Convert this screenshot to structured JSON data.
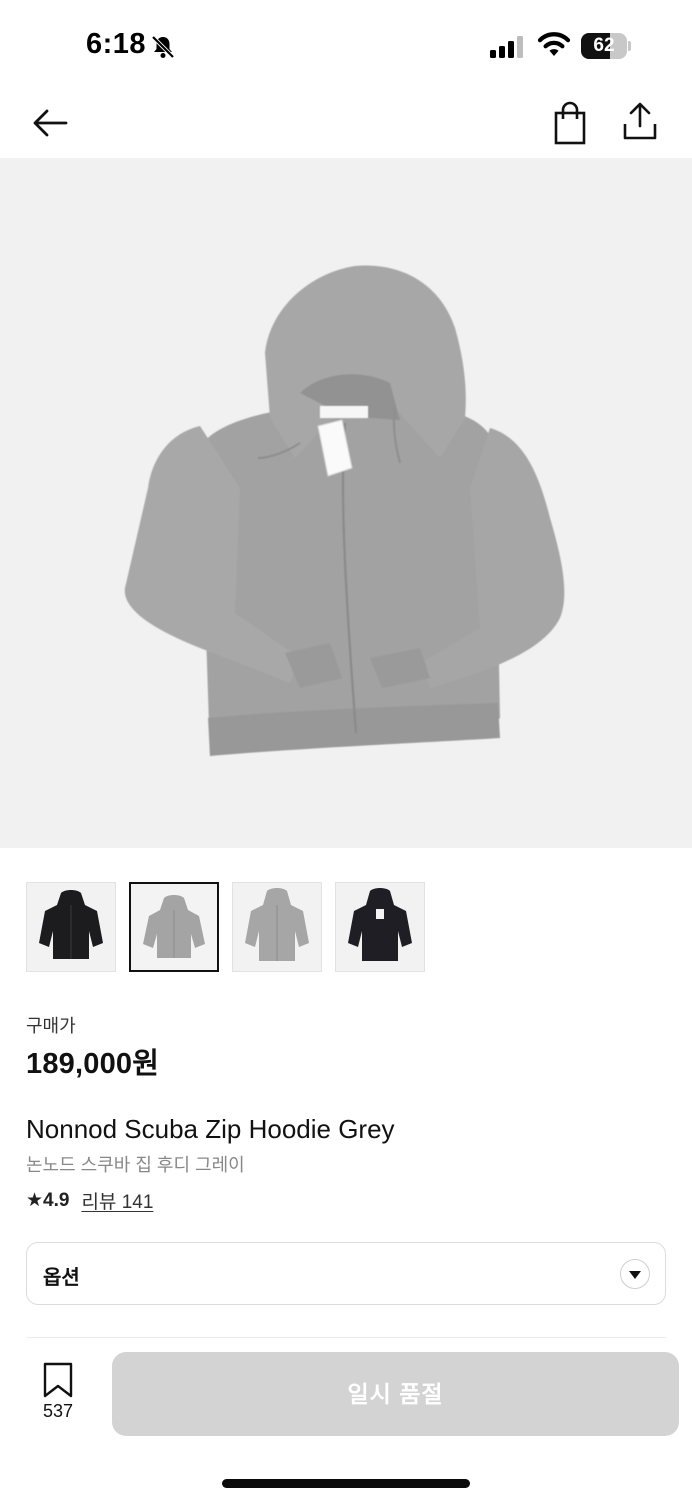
{
  "status_bar": {
    "time": "6:18",
    "battery_level": "62",
    "battery_fraction": 0.62
  },
  "nav": {
    "back_icon": "arrow-left-icon",
    "bag_icon": "shopping-bag-icon",
    "share_icon": "share-icon"
  },
  "gallery": {
    "hero_image": "grey-zip-hoodie",
    "thumbnails": [
      {
        "color": "black",
        "selected": false
      },
      {
        "color": "grey",
        "selected": true
      },
      {
        "color": "grey",
        "selected": false
      },
      {
        "color": "black",
        "selected": false
      }
    ]
  },
  "product": {
    "price_label": "구매가",
    "price": "189,000원",
    "name_en": "Nonnod Scuba Zip Hoodie Grey",
    "name_ko": "논노드 스쿠바 집 후디 그레이",
    "rating": "★4.9",
    "reviews_link": "리뷰 141"
  },
  "option": {
    "label": "옵션"
  },
  "bottom_bar": {
    "bookmark_count": "537",
    "cta_label": "일시 품절"
  },
  "colors": {
    "hero_bg": "#f1f1f1",
    "hoodie_grey": "#a4a4a4",
    "hoodie_black": "#1c1c1f",
    "cta_disabled": "#d3d3d3"
  }
}
